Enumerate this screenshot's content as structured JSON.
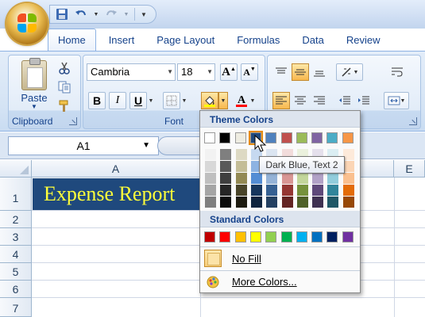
{
  "tabs": [
    "Home",
    "Insert",
    "Page Layout",
    "Formulas",
    "Data",
    "Review"
  ],
  "active_tab": "Home",
  "clipboard": {
    "paste_label": "Paste",
    "group_label": "Clipboard"
  },
  "font": {
    "name": "Cambria",
    "size": "18",
    "bold": "B",
    "italic": "I",
    "underline": "U",
    "group_label": "Font"
  },
  "name_box": "A1",
  "columns": [
    "A",
    "E"
  ],
  "rows": [
    "1",
    "2",
    "3",
    "4",
    "5",
    "6",
    "7"
  ],
  "title_cell": "Expense Report",
  "palette": {
    "theme_heading": "Theme Colors",
    "standard_heading": "Standard Colors",
    "no_fill": "No Fill",
    "more_colors": "More Colors...",
    "tooltip": "Dark Blue, Text 2",
    "theme_top": [
      "#ffffff",
      "#000000",
      "#eeece1",
      "#1f497d",
      "#4f81bd",
      "#c0504d",
      "#9bbb59",
      "#8064a2",
      "#4bacc6",
      "#f79646"
    ],
    "theme_shades": [
      [
        "#f2f2f2",
        "#7f7f7f",
        "#ddd9c3",
        "#c6d9f0",
        "#dbe5f1",
        "#f2dcdb",
        "#ebf1dd",
        "#e5e0ec",
        "#dbeef3",
        "#fdeada"
      ],
      [
        "#d8d8d8",
        "#595959",
        "#c4bd97",
        "#8db3e2",
        "#b8cce4",
        "#e5b9b7",
        "#d7e3bc",
        "#ccc1d9",
        "#b7dde8",
        "#fbd5b5"
      ],
      [
        "#bfbfbf",
        "#3f3f3f",
        "#938953",
        "#548dd4",
        "#95b3d7",
        "#d99694",
        "#c3d69b",
        "#b2a2c7",
        "#92cddc",
        "#fac08f"
      ],
      [
        "#a5a5a5",
        "#262626",
        "#494429",
        "#17365d",
        "#366092",
        "#953734",
        "#76923c",
        "#5f497a",
        "#31859b",
        "#e36c09"
      ],
      [
        "#7f7f7f",
        "#0c0c0c",
        "#1d1b10",
        "#0f243e",
        "#244061",
        "#632423",
        "#4f6128",
        "#3f3151",
        "#205867",
        "#974806"
      ]
    ],
    "standard": [
      "#c00000",
      "#ff0000",
      "#ffc000",
      "#ffff00",
      "#92d050",
      "#00b050",
      "#00b0f0",
      "#0070c0",
      "#002060",
      "#7030a0"
    ],
    "selected_index": 3
  },
  "accent": "#1f497d"
}
